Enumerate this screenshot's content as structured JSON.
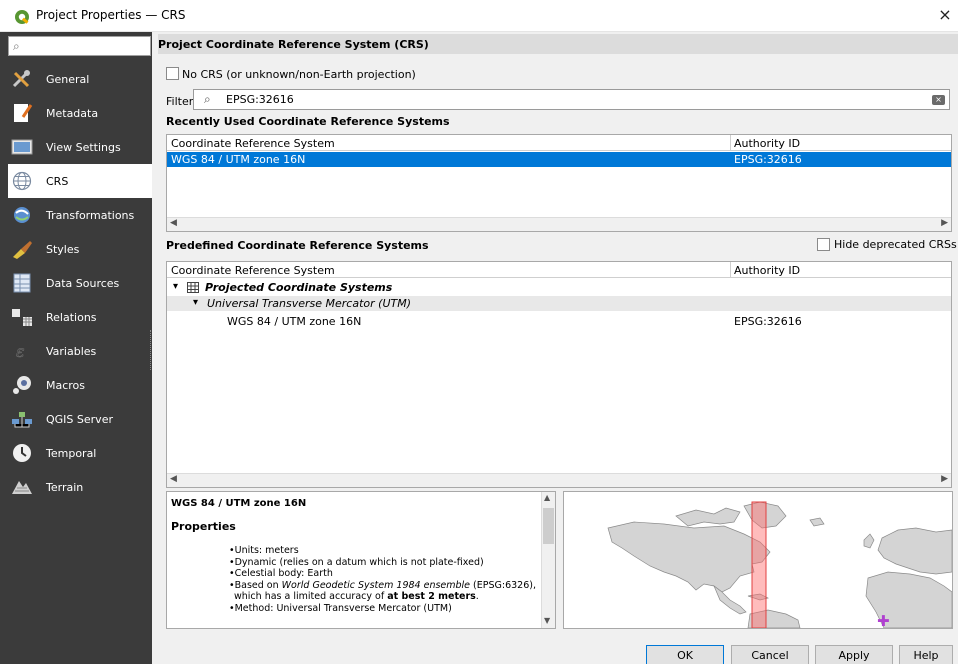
{
  "window": {
    "title": "Project Properties — CRS",
    "close_glyph": "×",
    "app_icon": "qgis-logo-icon"
  },
  "sidebar": {
    "search_icon": "⌕",
    "items": [
      {
        "label": "General",
        "icon": "tools-icon"
      },
      {
        "label": "Metadata",
        "icon": "metadata-icon"
      },
      {
        "label": "View Settings",
        "icon": "view-settings-icon"
      },
      {
        "label": "CRS",
        "icon": "globe-icon",
        "selected": true
      },
      {
        "label": "Transformations",
        "icon": "transformations-icon"
      },
      {
        "label": "Styles",
        "icon": "styles-icon"
      },
      {
        "label": "Data Sources",
        "icon": "data-sources-icon"
      },
      {
        "label": "Relations",
        "icon": "relations-icon"
      },
      {
        "label": "Variables",
        "icon": "variables-icon"
      },
      {
        "label": "Macros",
        "icon": "macros-icon"
      },
      {
        "label": "QGIS Server",
        "icon": "qgis-server-icon"
      },
      {
        "label": "Temporal",
        "icon": "clock-icon"
      },
      {
        "label": "Terrain",
        "icon": "terrain-icon"
      }
    ]
  },
  "main": {
    "header": "Project Coordinate Reference System (CRS)",
    "no_crs_label": "No CRS (or unknown/non-Earth projection)",
    "filter_label": "Filter",
    "filter_value": "EPSG:32616",
    "filter_icon": "⌕",
    "filter_clear_glyph": "×",
    "recent": {
      "heading": "Recently Used Coordinate Reference Systems",
      "col_crs": "Coordinate Reference System",
      "col_auth": "Authority ID",
      "rows": [
        {
          "crs": "WGS 84 / UTM zone 16N",
          "auth": "EPSG:32616",
          "selected": true
        }
      ]
    },
    "predefined": {
      "heading": "Predefined Coordinate Reference Systems",
      "hide_deprecated_label": "Hide deprecated CRSs",
      "col_crs": "Coordinate Reference System",
      "col_auth": "Authority ID",
      "group": "Projected Coordinate Systems",
      "subgroup": "Universal Transverse Mercator (UTM)",
      "item_crs": "WGS 84 / UTM zone 16N",
      "item_auth": "EPSG:32616",
      "expand_glyph": "▾"
    },
    "scroll_left": "◀",
    "scroll_right": "▶",
    "info": {
      "name": "WGS 84 / UTM zone 16N",
      "properties_heading": "Properties",
      "units": "Units: meters",
      "dynamic": "Dynamic (relies on a datum which is not plate-fixed)",
      "celestial": "Celestial body: Earth",
      "based_on_prefix": "Based on ",
      "based_on_italic": "World Geodetic System 1984 ensemble",
      "based_on_suffix": " (EPSG:6326),",
      "accuracy_prefix": "which has a limited accuracy of ",
      "accuracy_bold": "at best 2 meters",
      "accuracy_suffix": ".",
      "method": "Method: Universal Transverse Mercator (UTM)",
      "scroll_up": "▲",
      "scroll_down": "▼"
    },
    "map": {
      "marker_glyph": "✚",
      "zone_color": "#ff6b6b",
      "marker_color": "#b040d0"
    }
  },
  "footer": {
    "ok": "OK",
    "cancel": "Cancel",
    "apply": "Apply",
    "help": "Help"
  },
  "colors": {
    "sidebar_bg": "#3b3b3b",
    "selection": "#0078d7",
    "group_row_bg": "#e8e8e8",
    "map_land": "#d4d4d4"
  }
}
